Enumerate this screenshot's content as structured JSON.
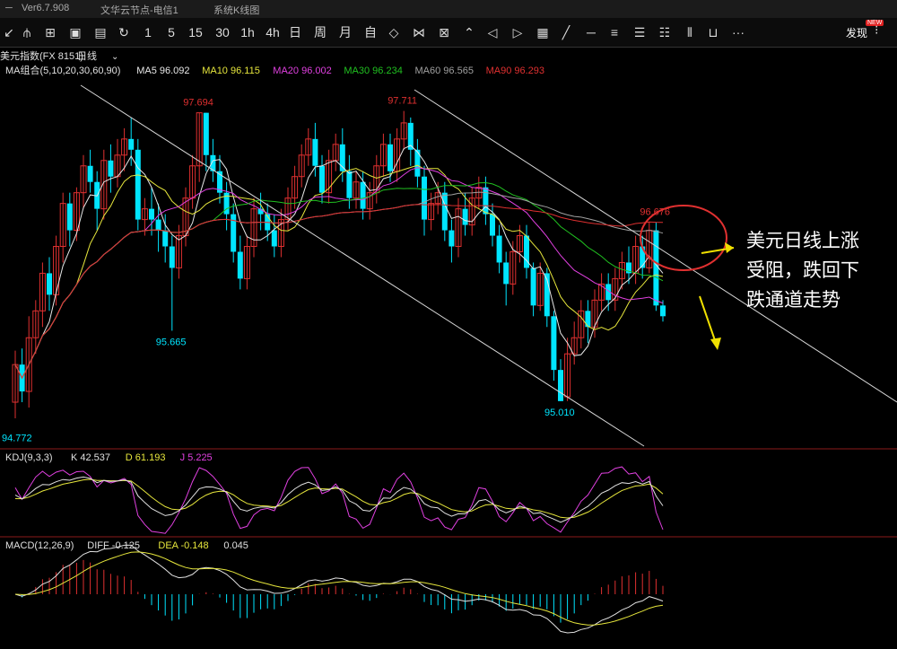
{
  "window": {
    "version": "Ver6.7.908",
    "node": "文华云节点-电信1",
    "tab": "系统K线图"
  },
  "toolbar": {
    "periods": [
      "1",
      "5",
      "15",
      "30",
      "1h",
      "4h",
      "日",
      "周",
      "月",
      "自"
    ],
    "discover": "发现",
    "new_badge": "NEW",
    "more": "···"
  },
  "header": {
    "symbol": "美元指数(FX 8151)",
    "period": "日线"
  },
  "ma_legend": [
    {
      "label": "MA组合(5,10,20,30,60,90)",
      "color": "#e0e0e0"
    },
    {
      "label": "MA5 96.092",
      "color": "#e8e8e8"
    },
    {
      "label": "MA10 96.115",
      "color": "#e6e63c"
    },
    {
      "label": "MA20 96.002",
      "color": "#e040e0"
    },
    {
      "label": "MA30 96.234",
      "color": "#20c020"
    },
    {
      "label": "MA60 96.565",
      "color": "#a0a0a0"
    },
    {
      "label": "MA90 96.293",
      "color": "#e03030"
    }
  ],
  "kdj_legend": [
    {
      "label": "KDJ(9,3,3)",
      "color": "#e0e0e0"
    },
    {
      "label": "K 42.537",
      "color": "#e0e0e0"
    },
    {
      "label": "D 61.193",
      "color": "#e6e63c"
    },
    {
      "label": "J 5.225",
      "color": "#e040e0"
    }
  ],
  "macd_legend": [
    {
      "label": "MACD(12,26,9)",
      "color": "#e0e0e0"
    },
    {
      "label": "DIFF -0.125",
      "color": "#e0e0e0"
    },
    {
      "label": "DEA -0.148",
      "color": "#e6e63c"
    },
    {
      "label": "0.045",
      "color": "#e0e0e0"
    }
  ],
  "annotation": {
    "lines": [
      "美元日线上涨",
      "受阻，跌回下",
      "跌通道走势"
    ]
  },
  "colors": {
    "up": "#e03030",
    "down": "#00e5ff",
    "channel": "#d8d8d8",
    "text_annotation": "#ffffff",
    "circle": "#e03030",
    "arrow": "#f0e000"
  },
  "chart_data": {
    "type": "candlestick",
    "ylim": [
      94.9,
      97.95
    ],
    "price_labels": [
      {
        "text": "97.694",
        "value": 97.694,
        "index": 27,
        "kind": "high"
      },
      {
        "text": "97.711",
        "value": 97.711,
        "index": 57,
        "kind": "high"
      },
      {
        "text": "95.665",
        "value": 95.665,
        "index": 23,
        "kind": "low"
      },
      {
        "text": "95.010",
        "value": 95.01,
        "index": 80,
        "kind": "low"
      },
      {
        "text": "96.676",
        "value": 96.676,
        "index": 94,
        "kind": "high"
      },
      {
        "text": "94.772",
        "value": 94.772,
        "index": 0,
        "kind": "low"
      }
    ],
    "candles": [
      [
        95.0,
        95.35,
        95.48,
        94.85
      ],
      [
        95.35,
        95.1,
        95.5,
        95.0
      ],
      [
        95.1,
        95.6,
        95.8,
        94.95
      ],
      [
        95.6,
        95.85,
        95.95,
        95.45
      ],
      [
        95.85,
        96.2,
        96.3,
        95.7
      ],
      [
        96.2,
        96.0,
        96.35,
        95.85
      ],
      [
        96.0,
        96.45,
        96.55,
        95.9
      ],
      [
        96.45,
        96.85,
        96.95,
        96.3
      ],
      [
        96.85,
        96.6,
        96.95,
        96.45
      ],
      [
        96.6,
        96.95,
        97.0,
        96.5
      ],
      [
        96.95,
        97.2,
        97.3,
        96.8
      ],
      [
        97.2,
        97.05,
        97.35,
        96.95
      ],
      [
        97.05,
        96.8,
        97.15,
        96.6
      ],
      [
        96.8,
        97.25,
        97.35,
        96.7
      ],
      [
        97.25,
        97.1,
        97.4,
        96.95
      ],
      [
        97.1,
        97.3,
        97.45,
        97.0
      ],
      [
        97.3,
        97.45,
        97.55,
        97.15
      ],
      [
        97.45,
        97.35,
        97.65,
        97.2
      ],
      [
        97.35,
        96.7,
        97.45,
        96.6
      ],
      [
        96.7,
        96.8,
        96.9,
        96.55
      ],
      [
        96.8,
        96.7,
        97.0,
        96.55
      ],
      [
        96.7,
        96.6,
        96.85,
        96.4
      ],
      [
        96.6,
        96.45,
        96.75,
        96.3
      ],
      [
        96.45,
        96.25,
        96.55,
        95.665
      ],
      [
        96.25,
        96.55,
        96.65,
        96.15
      ],
      [
        96.55,
        96.9,
        97.0,
        96.45
      ],
      [
        96.9,
        97.2,
        97.3,
        96.8
      ],
      [
        97.2,
        97.694,
        97.694,
        97.05
      ],
      [
        97.694,
        97.3,
        97.694,
        97.15
      ],
      [
        97.3,
        97.15,
        97.45,
        97.05
      ],
      [
        97.15,
        96.95,
        97.3,
        96.85
      ],
      [
        96.95,
        96.75,
        97.05,
        96.6
      ],
      [
        96.75,
        96.4,
        96.85,
        96.3
      ],
      [
        96.4,
        96.15,
        96.55,
        96.05
      ],
      [
        96.15,
        96.45,
        96.55,
        96.05
      ],
      [
        96.45,
        96.8,
        96.9,
        96.35
      ],
      [
        96.8,
        96.75,
        96.95,
        96.6
      ],
      [
        96.75,
        96.6,
        96.85,
        96.5
      ],
      [
        96.6,
        96.45,
        96.75,
        96.35
      ],
      [
        96.45,
        96.7,
        96.8,
        96.35
      ],
      [
        96.7,
        96.9,
        97.0,
        96.6
      ],
      [
        96.9,
        97.1,
        97.2,
        96.8
      ],
      [
        97.1,
        97.3,
        97.4,
        97.0
      ],
      [
        97.3,
        97.45,
        97.55,
        97.2
      ],
      [
        97.45,
        97.2,
        97.6,
        97.1
      ],
      [
        97.2,
        96.95,
        97.3,
        96.85
      ],
      [
        96.95,
        97.25,
        97.35,
        96.85
      ],
      [
        97.25,
        97.4,
        97.5,
        97.15
      ],
      [
        97.4,
        97.15,
        97.55,
        97.05
      ],
      [
        97.15,
        96.9,
        97.3,
        96.8
      ],
      [
        96.9,
        97.05,
        97.15,
        96.8
      ],
      [
        97.05,
        96.8,
        97.15,
        96.7
      ],
      [
        96.8,
        96.95,
        97.05,
        96.7
      ],
      [
        96.95,
        97.2,
        97.3,
        96.85
      ],
      [
        97.2,
        97.4,
        97.5,
        97.1
      ],
      [
        97.4,
        97.15,
        97.5,
        97.05
      ],
      [
        97.15,
        97.45,
        97.55,
        97.05
      ],
      [
        97.45,
        97.6,
        97.711,
        97.35
      ],
      [
        97.6,
        97.35,
        97.65,
        97.2
      ],
      [
        97.35,
        97.1,
        97.45,
        97.0
      ],
      [
        97.1,
        96.7,
        97.2,
        96.55
      ],
      [
        96.7,
        96.85,
        96.95,
        96.6
      ],
      [
        96.85,
        96.95,
        97.05,
        96.75
      ],
      [
        96.95,
        96.6,
        97.05,
        96.5
      ],
      [
        96.6,
        96.45,
        96.7,
        96.3
      ],
      [
        96.45,
        96.8,
        96.9,
        96.35
      ],
      [
        96.8,
        96.65,
        96.95,
        96.55
      ],
      [
        96.65,
        96.9,
        97.0,
        96.55
      ],
      [
        96.9,
        97.0,
        97.1,
        96.8
      ],
      [
        97.0,
        96.75,
        97.1,
        96.65
      ],
      [
        96.75,
        96.55,
        96.85,
        96.45
      ],
      [
        96.55,
        96.3,
        96.65,
        96.2
      ],
      [
        96.3,
        96.1,
        96.4,
        95.9
      ],
      [
        96.1,
        96.4,
        96.5,
        96.0
      ],
      [
        96.4,
        96.55,
        96.65,
        96.3
      ],
      [
        96.55,
        96.25,
        96.65,
        96.15
      ],
      [
        96.25,
        95.9,
        96.3,
        95.8
      ],
      [
        95.9,
        96.2,
        96.3,
        95.85
      ],
      [
        96.2,
        95.8,
        96.25,
        95.7
      ],
      [
        95.8,
        95.3,
        95.85,
        95.2
      ],
      [
        95.3,
        95.01,
        95.4,
        95.01
      ],
      [
        95.05,
        95.45,
        95.6,
        95.01
      ],
      [
        95.45,
        95.6,
        95.75,
        95.35
      ],
      [
        95.6,
        95.85,
        95.95,
        95.5
      ],
      [
        95.85,
        95.7,
        95.95,
        95.55
      ],
      [
        95.7,
        95.95,
        96.05,
        95.6
      ],
      [
        95.95,
        96.1,
        96.2,
        95.85
      ],
      [
        96.1,
        95.95,
        96.2,
        95.85
      ],
      [
        95.95,
        96.15,
        96.25,
        95.85
      ],
      [
        96.15,
        96.3,
        96.4,
        96.05
      ],
      [
        96.3,
        96.2,
        96.45,
        96.1
      ],
      [
        96.2,
        96.45,
        96.55,
        96.1
      ],
      [
        96.45,
        96.25,
        96.55,
        96.15
      ],
      [
        96.25,
        96.6,
        96.676,
        96.2
      ],
      [
        96.6,
        95.9,
        96.676,
        95.85
      ],
      [
        95.9,
        95.8,
        95.95,
        95.75
      ]
    ],
    "kdj": {
      "ylim": [
        0,
        100
      ],
      "k": [],
      "d": [],
      "j": []
    },
    "macd": {
      "ylim": [
        -0.5,
        0.5
      ],
      "diff": [],
      "dea": [],
      "hist": []
    }
  }
}
